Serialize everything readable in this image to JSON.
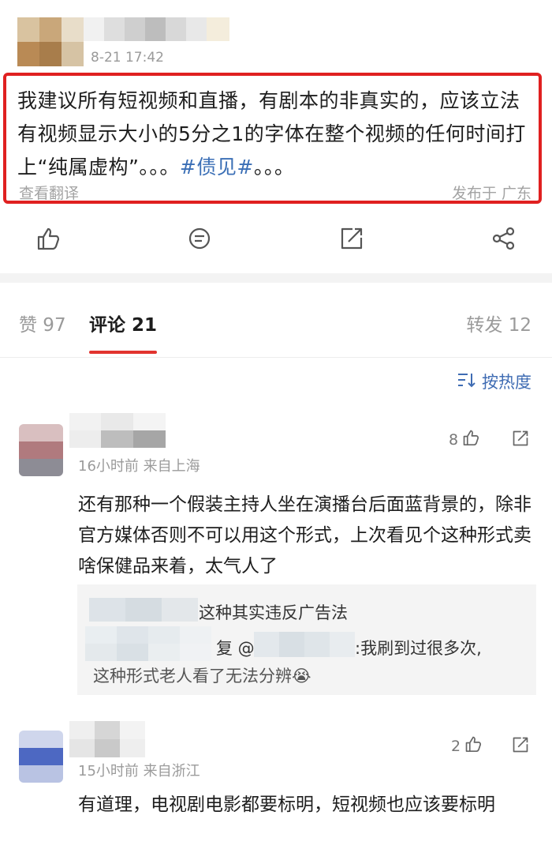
{
  "post": {
    "time": "8-21 17:42",
    "text_before": "我建议所有短视频和直播，有剧本的非真实的，应该立法有视频显示大小的5分之1的字体在整个视频的任何时间打上“纯属虚构”。。。",
    "hashtag": "#债见#",
    "text_after": "。。。",
    "translate_label": "查看翻译",
    "location_label": "发布于 广东",
    "actions": [
      "like-icon",
      "comment-icon",
      "share-icon",
      "more-share-icon"
    ]
  },
  "tabs": {
    "likes": "赞 97",
    "comments": "评论 21",
    "reposts": "转发 12",
    "active": "comments"
  },
  "sort_label": "按热度",
  "comments": [
    {
      "meta": "16小时前   来自上海",
      "likes": "8",
      "text": "还有那种一个假装主持人坐在演播台后面蓝背景的，除非官方媒体否则不可以用这个形式，上次看见个这种形式卖啥保健品来着，太气人了",
      "replies": [
        {
          "text": "这种其实违反广告法"
        },
        {
          "prefix": "复 @",
          "text": ":我刷到过很多次,",
          "text2": "这种形式老人看了无法分辨😭"
        }
      ]
    },
    {
      "meta": "15小时前   来自浙江",
      "likes": "2",
      "text": "有道理，电视剧电影都要标明，短视频也应该要标明"
    }
  ],
  "colors": {
    "highlight_border": "#e02020",
    "link": "#3b6fb6",
    "tab_underline": "#e2342f"
  }
}
